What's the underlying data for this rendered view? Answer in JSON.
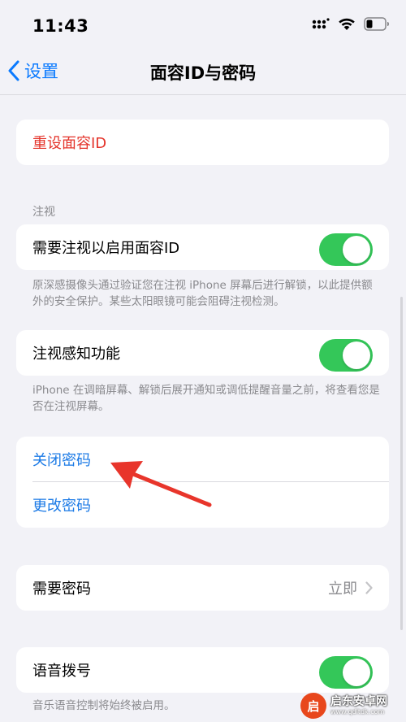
{
  "status_bar": {
    "time": "11:43"
  },
  "nav": {
    "back_label": "设置",
    "title": "面容ID与密码"
  },
  "reset_group": {
    "reset_face_id": "重设面容ID"
  },
  "attention_section": {
    "header": "注视",
    "require_attention_label": "需要注视以启用面容ID",
    "require_attention_on": true,
    "require_attention_footer": "原深感摄像头通过验证您在注视 iPhone 屏幕后进行解锁，以此提供额外的安全保护。某些太阳眼镜可能会阻碍注视检测。",
    "attention_aware_label": "注视感知功能",
    "attention_aware_on": true,
    "attention_aware_footer": "iPhone 在调暗屏幕、解锁后展开通知或调低提醒音量之前，将查看您是否在注视屏幕。"
  },
  "passcode_group": {
    "turn_off_passcode": "关闭密码",
    "change_passcode": "更改密码"
  },
  "require_passcode": {
    "label": "需要密码",
    "value": "立即"
  },
  "voice_dial": {
    "label": "语音拨号",
    "on": true,
    "footer": "音乐语音控制将始终被启用。"
  },
  "watermark": {
    "name": "启东安卓网",
    "url": "www.qdltdk.com",
    "logo_char": "启"
  },
  "colors": {
    "accent_blue": "#0a7aff",
    "destructive_red": "#e4332a",
    "toggle_green": "#34c759",
    "background": "#f2f2f7",
    "annotation_red": "#e8352b"
  }
}
